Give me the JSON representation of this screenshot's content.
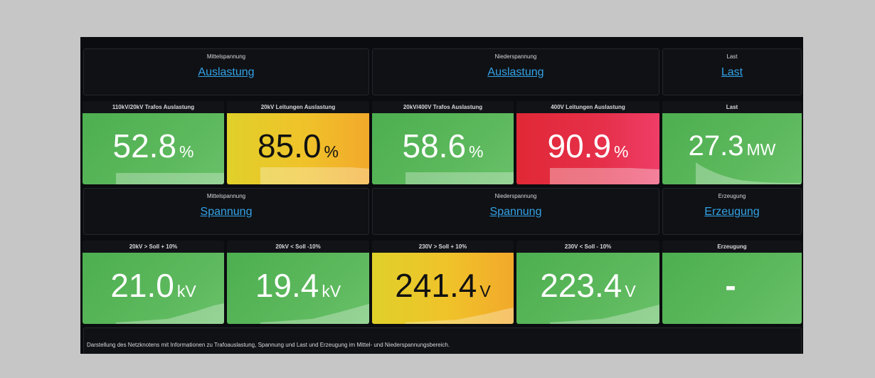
{
  "row1": {
    "mittel": {
      "title": "Mittelspannung",
      "link": "Auslastung"
    },
    "nieder": {
      "title": "Niederspannung",
      "link": "Auslastung"
    },
    "last": {
      "title": "Last",
      "link": "Last"
    }
  },
  "stats1": [
    {
      "title": "110kV/20kV Trafos Auslastung",
      "value": "52.8",
      "unit": "%"
    },
    {
      "title": "20kV Leitungen Auslastung",
      "value": "85.0",
      "unit": "%"
    },
    {
      "title": "20kV/400V Trafos Auslastung",
      "value": "58.6",
      "unit": "%"
    },
    {
      "title": "400V Leitungen Auslastung",
      "value": "90.9",
      "unit": "%"
    },
    {
      "title": "Last",
      "value": "27.3",
      "unit": "MW"
    }
  ],
  "row2": {
    "mittel": {
      "title": "Mittelspannung",
      "link": "Spannung"
    },
    "nieder": {
      "title": "Niederspannung",
      "link": "Spannung"
    },
    "erzeugung": {
      "title": "Erzeugung",
      "link": "Erzeugung"
    }
  },
  "stats2": [
    {
      "title": "20kV > Soll + 10%",
      "value": "21.0",
      "unit": "kV"
    },
    {
      "title": "20kV < Soll -10%",
      "value": "19.4",
      "unit": "kV"
    },
    {
      "title": "230V > Soll + 10%",
      "value": "241.4",
      "unit": "V"
    },
    {
      "title": "230V < Soll - 10%",
      "value": "223.4",
      "unit": "V"
    },
    {
      "title": "Erzeugung",
      "value": "-",
      "unit": ""
    }
  ],
  "footer": {
    "text": "Darstellung des Netzknotens mit Informationen zu Trafoauslastung, Spannung und Last und Erzeugung im Mittel- und Niederspannungsbereich."
  },
  "colors": {
    "green": "#5cb85c",
    "yellow": "#f2c12e",
    "red": "#e6304a",
    "link": "#33a2e5"
  }
}
